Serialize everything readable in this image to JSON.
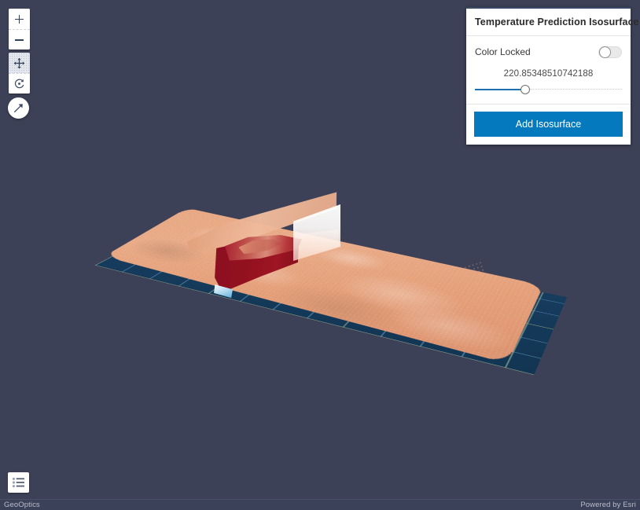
{
  "app": {
    "background_color": "#3d4157"
  },
  "toolbar": {
    "zoom_in": {
      "label": "+",
      "icon": "plus-icon",
      "tooltip": "Zoom in"
    },
    "zoom_out": {
      "label": "−",
      "icon": "minus-icon",
      "tooltip": "Zoom out"
    },
    "pan": {
      "icon": "pan-move-icon",
      "tooltip": "Pan",
      "active": true
    },
    "rotate": {
      "icon": "rotate-icon",
      "tooltip": "Rotate"
    },
    "compass": {
      "icon": "navigate-arrow-icon",
      "tooltip": "Default view"
    },
    "legend": {
      "icon": "legend-list-icon",
      "tooltip": "Legend"
    }
  },
  "panel": {
    "title": "Temperature Prediction Isosurface",
    "color_locked": {
      "label": "Color Locked",
      "value": false
    },
    "slider": {
      "value_text": "220.85348510742188",
      "value": 220.85348510742188,
      "fill_percent": 34
    },
    "add_button": {
      "label": "Add Isosurface",
      "color": "#0579be"
    }
  },
  "statusbar": {
    "left_text": "GeoOptics",
    "right_text": "Powered by Esri"
  },
  "scene": {
    "isosurface_color": "#e8a883",
    "slice_color": "#93111f",
    "clip_plane_color": "#ffffff",
    "basemap_color": "#163c5e",
    "grid_line_color": "#6eaad2",
    "graticule_color": "#b09e44"
  }
}
